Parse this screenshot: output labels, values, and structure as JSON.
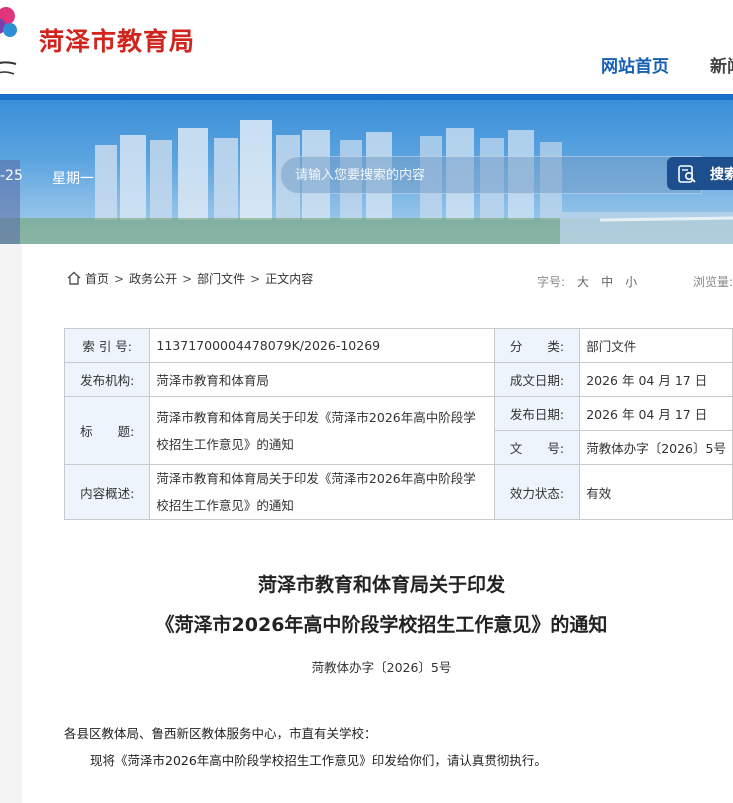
{
  "header": {
    "title": "菏泽市教育局",
    "nav_home": "网站首页",
    "nav_news": "新闻"
  },
  "banner": {
    "date": "-25",
    "weekday": "星期一",
    "search_placeholder": "请输入您要搜索的内容",
    "search_button": "搜索"
  },
  "breadcrumb": {
    "home": "首页",
    "sep": ">",
    "item1": "政务公开",
    "item2": "部门文件",
    "item3": "正文内容"
  },
  "tools": {
    "fontsize_label": "字号:",
    "large": "大",
    "medium": "中",
    "small": "小",
    "views_label": "浏览量:"
  },
  "info": {
    "index_label": "索 引 号:",
    "index_value": "11371700004478079K/2026-10269",
    "category_label": "分　　类:",
    "category_value": "部门文件",
    "publisher_label": "发布机构:",
    "publisher_value": "菏泽市教育和体育局",
    "created_label": "成文日期:",
    "created_value": "2026 年 04 月 17 日",
    "title_label": "标　　题:",
    "title_value": "菏泽市教育和体育局关于印发《菏泽市2026年高中阶段学校招生工作意见》的通知",
    "published_label": "发布日期:",
    "published_value": "2026 年 04 月 17 日",
    "docno_label": "文　　号:",
    "docno_value": "菏教体办字〔2026〕5号",
    "summary_label": "内容概述:",
    "summary_value": "菏泽市教育和体育局关于印发《菏泽市2026年高中阶段学校招生工作意见》的通知",
    "status_label": "效力状态:",
    "status_value": "有效"
  },
  "article": {
    "title_line1": "菏泽市教育和体育局关于印发",
    "title_line2": "《菏泽市2026年高中阶段学校招生工作意见》的通知",
    "doc_number": "菏教体办字〔2026〕5号",
    "para1": "各县区教体局、鲁西新区教体服务中心，市直有关学校：",
    "para2": "现将《菏泽市2026年高中阶段学校招生工作意见》印发给你们，请认真贯彻执行。"
  },
  "colors": {
    "title_red": "#d0241c",
    "nav_blue": "#1660b3",
    "bar_blue": "#1a6fc9",
    "label_bg": "#edf4fb"
  }
}
